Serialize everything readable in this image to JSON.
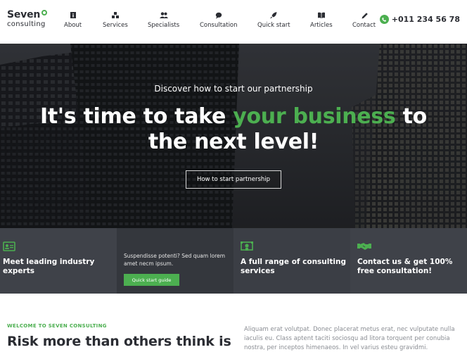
{
  "brand": {
    "name": "Seven",
    "sub": "consulting"
  },
  "nav": [
    {
      "label": "About",
      "icon": "info-icon"
    },
    {
      "label": "Services",
      "icon": "cubes-icon"
    },
    {
      "label": "Specialists",
      "icon": "users-icon"
    },
    {
      "label": "Consultation",
      "icon": "chat-icon"
    },
    {
      "label": "Quick start",
      "icon": "rocket-icon"
    },
    {
      "label": "Articles",
      "icon": "book-icon"
    },
    {
      "label": "Contact",
      "icon": "pencil-icon"
    }
  ],
  "phone": {
    "number": "+011 234 56 78",
    "icon": "whatsapp-icon"
  },
  "hero": {
    "kicker": "Discover how to start our partnership",
    "title_pre": "It's time to take ",
    "title_accent": "your business",
    "title_mid": " to",
    "title_line2": "the next level!",
    "button": "How to start partnership"
  },
  "features": [
    {
      "icon": "id-card-icon",
      "title": "Meet leading industry experts"
    },
    {
      "text": "Suspendisse potenti? Sed quam lorem amet necm ipsum.",
      "button": "Quick start guide"
    },
    {
      "icon": "certificate-icon",
      "title": "A full range of consulting services"
    },
    {
      "icon": "handshake-icon",
      "title": "Contact us & get 100% free consultation!"
    }
  ],
  "about": {
    "kicker": "WELCOME TO SEVEN CONSULTING",
    "heading": "Risk more than others think is",
    "paragraph": "Aliquam erat volutpat. Donec placerat metus erat, nec vulputate nulla iaculis eu. Class aptent taciti sociosqu ad litora torquent per conubia nostra, per inceptos himenaeos. In vel varius esteu gravidmi."
  },
  "colors": {
    "accent": "#4caf50",
    "dark": "#2b2d33",
    "strip": "#3f4249"
  }
}
